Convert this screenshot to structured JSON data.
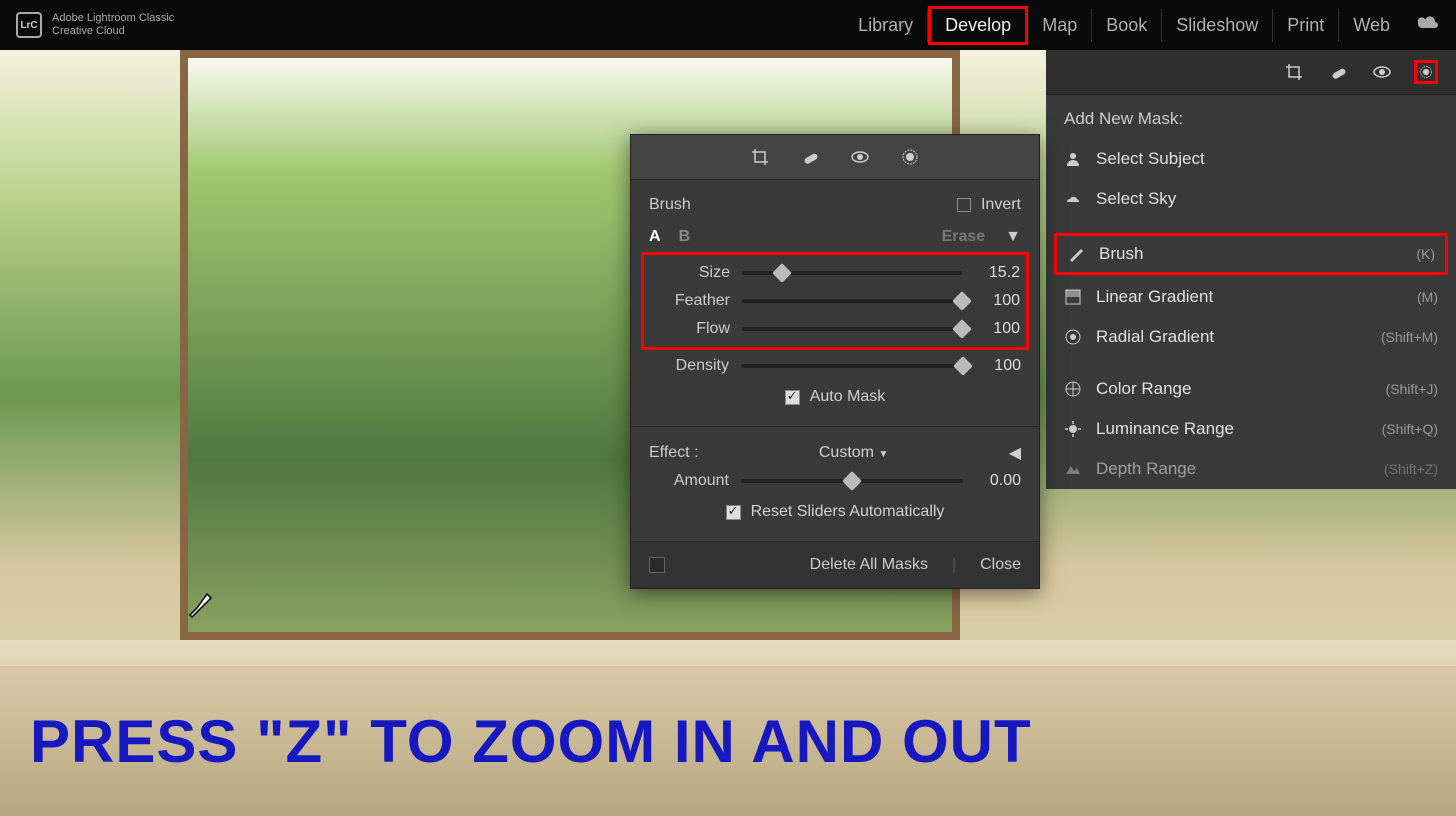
{
  "app": {
    "logo_abbrev": "LrC",
    "title_line1": "Adobe Lightroom Classic",
    "title_line2": "Creative Cloud"
  },
  "nav": {
    "items": [
      "Library",
      "Develop",
      "Map",
      "Book",
      "Slideshow",
      "Print",
      "Web"
    ],
    "active": "Develop"
  },
  "mask_panel": {
    "header": "Add New Mask:",
    "items": [
      {
        "label": "Select Subject",
        "shortcut": ""
      },
      {
        "label": "Select Sky",
        "shortcut": ""
      },
      {
        "label": "Brush",
        "shortcut": "(K)"
      },
      {
        "label": "Linear Gradient",
        "shortcut": "(M)"
      },
      {
        "label": "Radial Gradient",
        "shortcut": "(Shift+M)"
      },
      {
        "label": "Color Range",
        "shortcut": "(Shift+J)"
      },
      {
        "label": "Luminance Range",
        "shortcut": "(Shift+Q)"
      },
      {
        "label": "Depth Range",
        "shortcut": "(Shift+Z)"
      }
    ]
  },
  "brush_panel": {
    "title": "Brush",
    "invert": "Invert",
    "a": "A",
    "b": "B",
    "erase": "Erase",
    "disclosure": "▼",
    "sliders": {
      "size": {
        "label": "Size",
        "value": "15.2",
        "percent": 18
      },
      "feather": {
        "label": "Feather",
        "value": "100",
        "percent": 100
      },
      "flow": {
        "label": "Flow",
        "value": "100",
        "percent": 100
      },
      "density": {
        "label": "Density",
        "value": "100",
        "percent": 100
      }
    },
    "auto_mask": "Auto Mask",
    "effect_label": "Effect :",
    "effect_value": "Custom",
    "effect_disclosure": "◀",
    "amount_label": "Amount",
    "amount_value": "0.00",
    "amount_percent": 50,
    "reset": "Reset Sliders Automatically",
    "delete_all": "Delete All Masks",
    "close": "Close"
  },
  "caption": "PRESS \"Z\" TO ZOOM IN AND OUT"
}
